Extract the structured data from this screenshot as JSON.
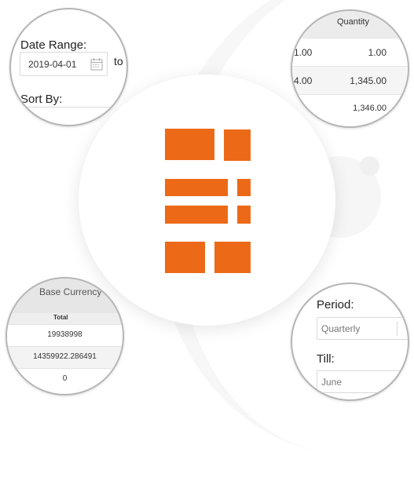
{
  "logo": {
    "name": "app-logo",
    "color": "#ec6a17"
  },
  "lenses": {
    "date_range": {
      "label": "Date Range:",
      "date_value": "2019-04-01",
      "date_icon": "calendar-icon",
      "to_label": "to",
      "sort_label": "Sort By:",
      "sort_partial": "..."
    },
    "quantity_table": {
      "header": "Quantity",
      "rows": [
        {
          "prev": "1.00",
          "quantity": "1.00"
        },
        {
          "prev": "4.00",
          "quantity": "1,345.00"
        },
        {
          "prev": ":",
          "quantity": "1,346.00"
        }
      ]
    },
    "base_currency": {
      "title": "Base Currency",
      "column": "Total",
      "rows": [
        "19938998",
        "14359922.286491",
        "0"
      ]
    },
    "period": {
      "period_label": "Period:",
      "period_value": "Quarterly",
      "till_label": "Till:",
      "till_value": "June"
    }
  }
}
